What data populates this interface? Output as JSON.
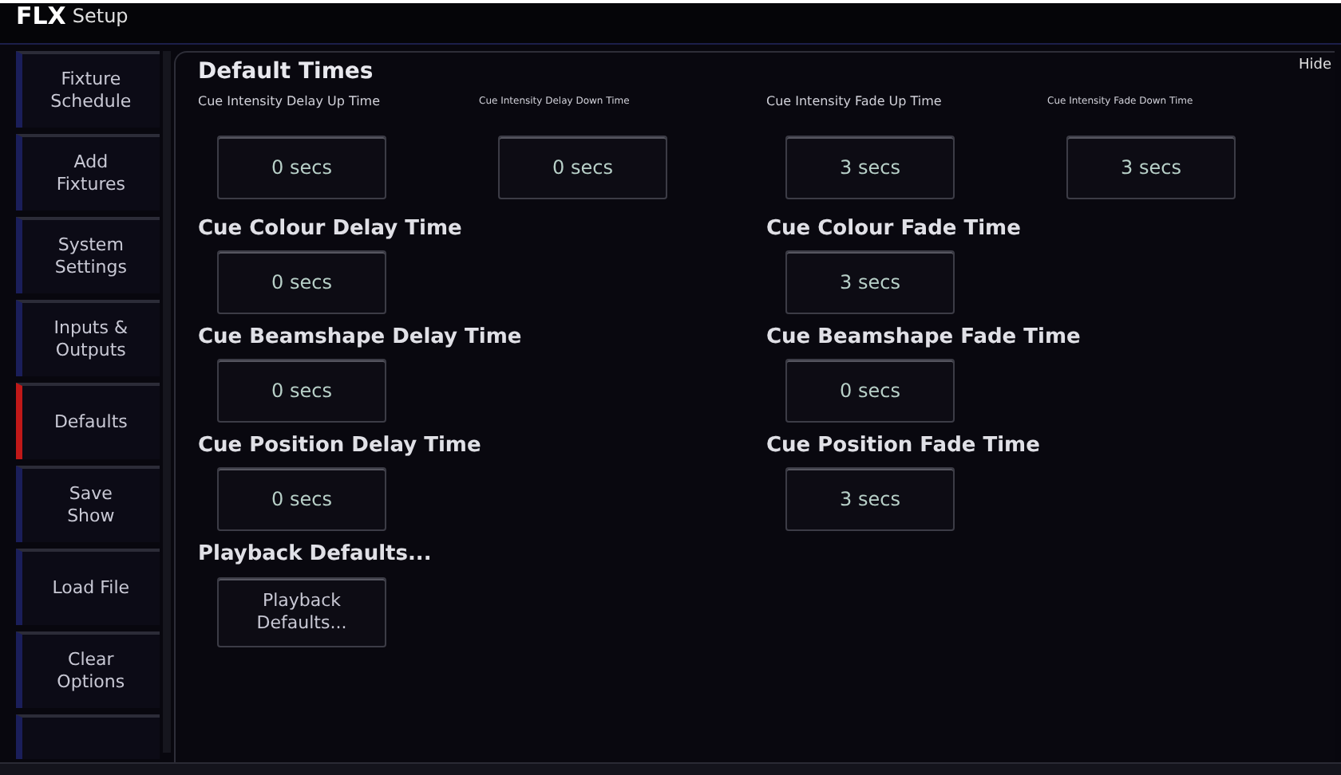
{
  "window": {
    "title_logo": "FLX",
    "title": "Setup"
  },
  "sidebar": {
    "items": [
      {
        "label": "Fixture Schedule",
        "selected": false
      },
      {
        "label": "Add Fixtures",
        "selected": false
      },
      {
        "label": "System Settings",
        "selected": false
      },
      {
        "label": "Inputs & Outputs",
        "selected": false
      },
      {
        "label": "Defaults",
        "selected": true
      },
      {
        "label": "Save Show",
        "selected": false
      },
      {
        "label": "Load File",
        "selected": false
      },
      {
        "label": "Clear Options",
        "selected": false
      },
      {
        "selected": false
      }
    ]
  },
  "panel": {
    "title": "Default Times",
    "hide": "Hide",
    "rows": [
      {
        "kind": "compact",
        "fields": [
          {
            "label": "Cue Intensity Delay Up Time",
            "value": "0 secs"
          },
          {
            "label": "Cue Intensity Delay Down Time",
            "value": "0 secs"
          },
          {
            "label": "Cue Intensity Fade Up Time",
            "value": "3 secs"
          },
          {
            "label": "Cue Intensity Fade Down Time",
            "value": "3 secs"
          }
        ]
      },
      {
        "kind": "pair",
        "fields": [
          {
            "label": "Cue Colour Delay Time",
            "value": "0 secs"
          },
          {
            "label": "Cue Colour Fade Time",
            "value": "3 secs"
          }
        ]
      },
      {
        "kind": "pair",
        "fields": [
          {
            "label": "Cue Beamshape Delay Time",
            "value": "0 secs"
          },
          {
            "label": "Cue Beamshape Fade Time",
            "value": "0 secs"
          }
        ]
      },
      {
        "kind": "pair",
        "fields": [
          {
            "label": "Cue Position Delay Time",
            "value": "0 secs"
          },
          {
            "label": "Cue Position Fade Time",
            "value": "3 secs"
          }
        ]
      }
    ],
    "playback": {
      "label": "Playback Defaults...",
      "button": "Playback Defaults..."
    }
  }
}
